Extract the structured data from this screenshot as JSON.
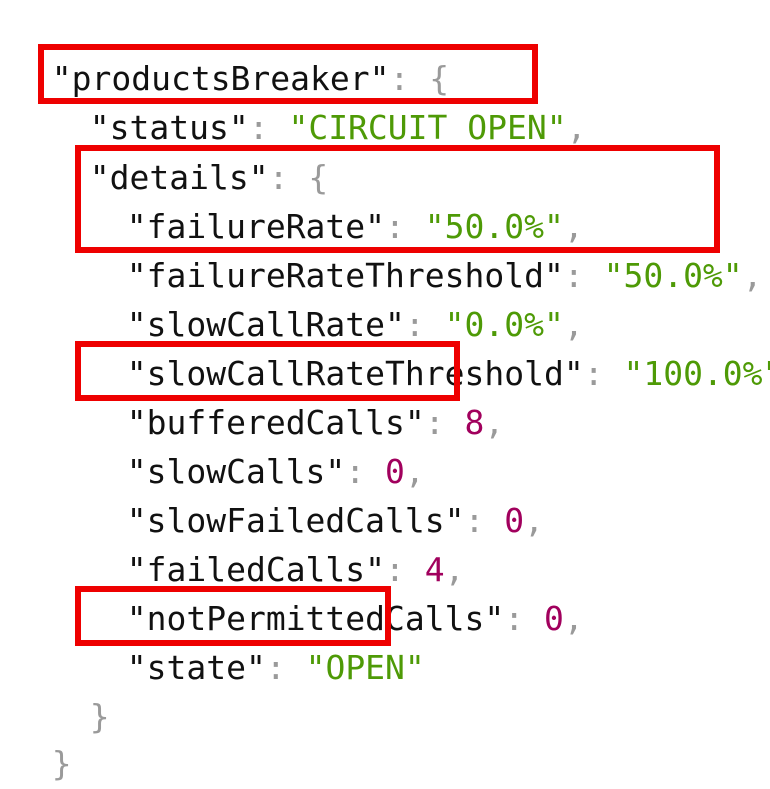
{
  "json": {
    "root_key": "\"productsBreaker\"",
    "colon": ": ",
    "open_brace": "{",
    "close_brace": "}",
    "comma": ",",
    "status_key": "\"status\"",
    "status_value": "\"CIRCUIT_OPEN\"",
    "details_key": "\"details\"",
    "fields": [
      {
        "key": "\"failureRate\"",
        "value": "\"50.0%\"",
        "type": "string"
      },
      {
        "key": "\"failureRateThreshold\"",
        "value": "\"50.0%\"",
        "type": "string"
      },
      {
        "key": "\"slowCallRate\"",
        "value": "\"0.0%\"",
        "type": "string"
      },
      {
        "key": "\"slowCallRateThreshold\"",
        "value": "\"100.0%\"",
        "type": "string"
      },
      {
        "key": "\"bufferedCalls\"",
        "value": "8",
        "type": "number"
      },
      {
        "key": "\"slowCalls\"",
        "value": "0",
        "type": "number"
      },
      {
        "key": "\"slowFailedCalls\"",
        "value": "0",
        "type": "number"
      },
      {
        "key": "\"failedCalls\"",
        "value": "4",
        "type": "number"
      },
      {
        "key": "\"notPermittedCalls\"",
        "value": "0",
        "type": "number"
      },
      {
        "key": "\"state\"",
        "value": "\"OPEN\"",
        "type": "string"
      }
    ]
  },
  "highlighted_fields": [
    "status",
    "failureRate",
    "failureRateThreshold",
    "bufferedCalls",
    "state"
  ],
  "colors": {
    "key": "#111111",
    "punctuation": "#9a9a9a",
    "string": "#4e9a06",
    "number": "#a1005d",
    "highlight": "#ee0000"
  }
}
